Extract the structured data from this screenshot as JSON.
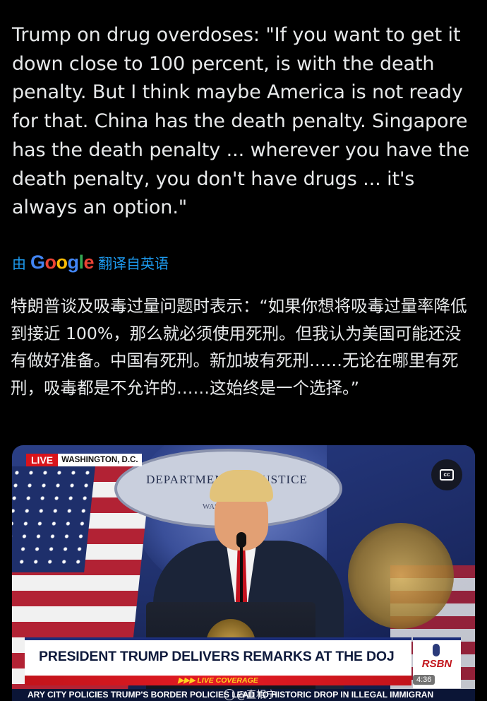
{
  "tweet": {
    "text": "Trump on drug overdoses: \"If you want to get it down close to 100 percent, is with the death penalty. But I think maybe America is not ready for that. China has the death penalty. Singapore has the death penalty ... wherever you have the death penalty, you don't have drugs ... it's always an option.\""
  },
  "translation": {
    "prefix": "由",
    "provider": "Google",
    "suffix": "翻译自英语",
    "text": "特朗普谈及吸毒过量问题时表示：“如果你想将吸毒过量率降低到接近 100%，那么就必须使用死刑。但我认为美国可能还没有做好准备。中国有死刑。新加坡有死刑……无论在哪里有死刑，吸毒都是不允许的……这始终是一个选择。”"
  },
  "media": {
    "live_label": "LIVE",
    "location": "WASHINGTON, D.C.",
    "seal_text": "DEPARTMENT OF JUSTICE",
    "seal_sub": "WASHINGTON",
    "cc_label": "cc",
    "headline": "PRESIDENT TRUMP DELIVERS REMARKS AT THE DOJ",
    "coverage": "▶▶▶ LIVE COVERAGE",
    "network": "RSBN",
    "ticker": "ARY CITY POLICIES     TRUMP'S BORDER POLICIES LEAD TO HISTORIC DROP IN ILLEGAL IMMIGRAN",
    "duration": "4:36",
    "watermark": "@直相宁"
  },
  "colors": {
    "background": "#000000",
    "text": "#e7e9ea",
    "link": "#1d9bf0",
    "live_red": "#d9141b",
    "coverage_yellow": "#ffd21f"
  }
}
